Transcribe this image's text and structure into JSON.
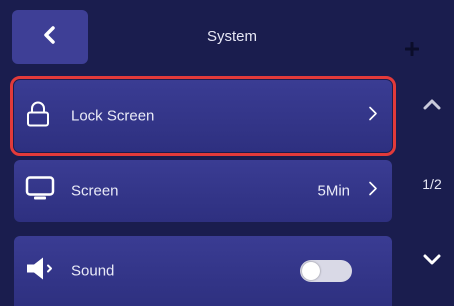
{
  "header": {
    "title": "System"
  },
  "rows": [
    {
      "label": "Lock Screen",
      "icon": "lock-icon",
      "value": "",
      "selected": true
    },
    {
      "label": "Screen",
      "icon": "monitor-icon",
      "value": "5Min"
    },
    {
      "label": "Sound",
      "icon": "speaker-icon",
      "toggle_on": false
    }
  ],
  "pagination": {
    "indicator": "1/2"
  },
  "colors": {
    "background": "#1a1d4e",
    "row": "#3a3c93",
    "back_button": "#3e3f96",
    "selection": "#e23a3a",
    "toggle_off": "#d9d9e6"
  }
}
